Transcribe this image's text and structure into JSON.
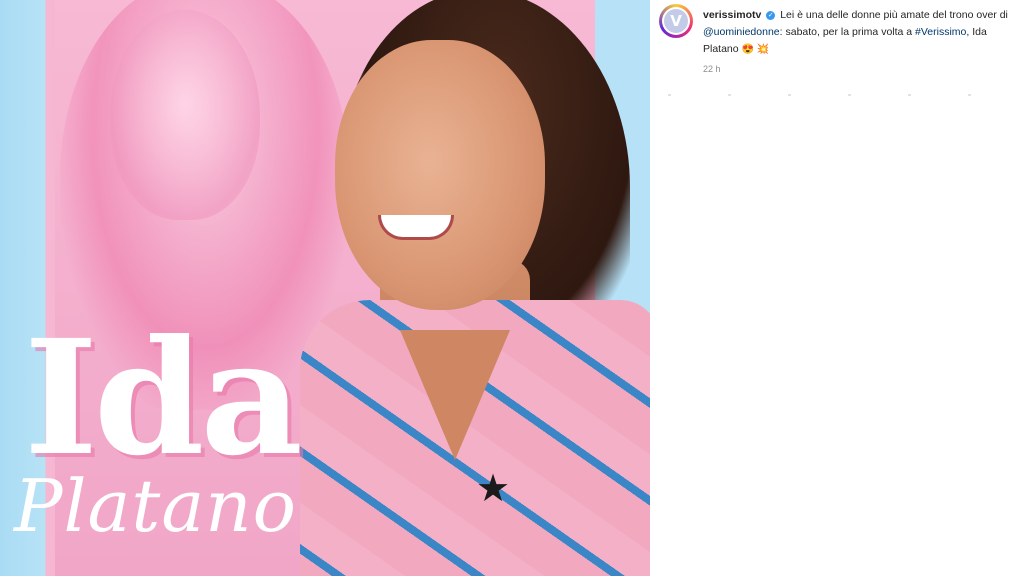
{
  "post": {
    "image_title_line1": "Ida",
    "image_title_line2": "Platano"
  },
  "sidebar": {
    "username": "verissimotv",
    "caption_text": "Lei è una delle donne più amate del trono over di",
    "mention": "@uominiedonne",
    "caption_text2": ": sabato, per la prima volta a ",
    "hashtag": "#Verissimo",
    "caption_text3": ", Ida Platano",
    "emojis": "😍 💥",
    "timestamp": "22 h",
    "avatar_letter": "V"
  },
  "colors": {
    "pink_bg": "#f3a9c9",
    "blue_bg": "#b7e2f6",
    "link": "#00376b",
    "verified": "#3897f0"
  }
}
